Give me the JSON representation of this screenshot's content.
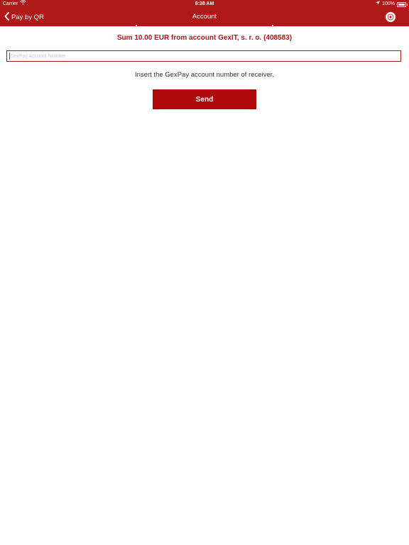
{
  "status_bar": {
    "carrier": "Carrier",
    "time": "8:38 AM",
    "battery_percent": "100%"
  },
  "nav": {
    "back_label": "Pay by QR",
    "title": "Account"
  },
  "main": {
    "summary": "Sum 10.00 EUR  from account GexIT, s. r. o. (408583)",
    "account_placeholder": "GexPay Account Number",
    "account_value": "",
    "hint": "Insert the GexPay account number of receiver.",
    "send_label": "Send"
  },
  "colors": {
    "accent": "#b01818",
    "button": "#b00a0a",
    "background": "#ffffff"
  },
  "icons": {
    "back": "chevron-left-icon",
    "wifi": "wifi-icon",
    "location": "location-arrow-icon",
    "battery": "battery-icon",
    "logo": "gexpay-logo-icon"
  }
}
